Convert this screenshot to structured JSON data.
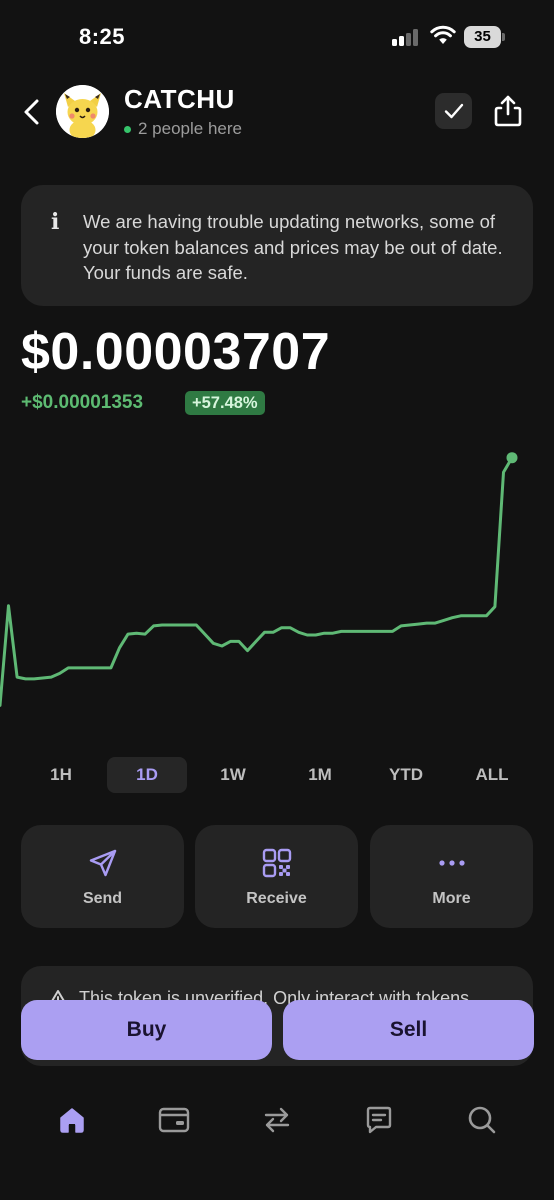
{
  "status_bar": {
    "time": "8:25",
    "battery": "35"
  },
  "header": {
    "token_name": "CATCHU",
    "presence": "2 people here"
  },
  "banner": {
    "icon": "info-icon",
    "message": "We are having trouble updating networks, some of your token balances and prices may be out of date. Your funds are safe."
  },
  "price": {
    "value": "$0.00003707",
    "change": "+$0.00001353",
    "change_pct": "+57.48%"
  },
  "chart_data": {
    "type": "line",
    "title": "",
    "xlabel": "",
    "ylabel": "",
    "range": "1D",
    "color": "#5fb975",
    "x": [
      0,
      1,
      2,
      3,
      4,
      5,
      6,
      7,
      8,
      9,
      10,
      11,
      12,
      13,
      14,
      15,
      16,
      17,
      18,
      19,
      20,
      21,
      22,
      23,
      24,
      25,
      26,
      27,
      28,
      29,
      30,
      31,
      32,
      33,
      34,
      35,
      36,
      37,
      38,
      39,
      40,
      41,
      42,
      43,
      44,
      45,
      46,
      47,
      48,
      49,
      50,
      51,
      52,
      53,
      54,
      55,
      56,
      57,
      58,
      59,
      60
    ],
    "y": [
      1e-05,
      2.09e-05,
      1.31e-05,
      1.29e-05,
      1.29e-05,
      1.3e-05,
      1.31e-05,
      1.35e-05,
      1.41e-05,
      1.41e-05,
      1.41e-05,
      1.41e-05,
      1.41e-05,
      1.41e-05,
      1.63e-05,
      1.78e-05,
      1.79e-05,
      1.78e-05,
      1.87e-05,
      1.88e-05,
      1.88e-05,
      1.88e-05,
      1.88e-05,
      1.88e-05,
      1.78e-05,
      1.68e-05,
      1.65e-05,
      1.7e-05,
      1.7e-05,
      1.6e-05,
      1.7e-05,
      1.8e-05,
      1.8e-05,
      1.85e-05,
      1.85e-05,
      1.8e-05,
      1.77e-05,
      1.77e-05,
      1.79e-05,
      1.79e-05,
      1.81e-05,
      1.81e-05,
      1.81e-05,
      1.81e-05,
      1.81e-05,
      1.81e-05,
      1.81e-05,
      1.87e-05,
      1.88e-05,
      1.89e-05,
      1.9e-05,
      1.9e-05,
      1.93e-05,
      1.96e-05,
      1.98e-05,
      1.98e-05,
      1.98e-05,
      1.98e-05,
      2.08e-05,
      3.55e-05,
      3.71e-05
    ],
    "ylim": [
      9.5e-06,
      3.75e-05
    ],
    "grid": false,
    "end_marker": true
  },
  "range_tabs": [
    {
      "label": "1H",
      "active": false
    },
    {
      "label": "1D",
      "active": true
    },
    {
      "label": "1W",
      "active": false
    },
    {
      "label": "1M",
      "active": false
    },
    {
      "label": "YTD",
      "active": false
    },
    {
      "label": "ALL",
      "active": false
    }
  ],
  "actions": {
    "send": {
      "label": "Send",
      "icon": "send-icon"
    },
    "receive": {
      "label": "Receive",
      "icon": "qr-code-icon"
    },
    "more": {
      "label": "More",
      "icon": "more-dots-icon"
    }
  },
  "warning": {
    "icon": "warning-icon",
    "text": "This token is unverified. Only interact with tokens"
  },
  "trade": {
    "buy": "Buy",
    "sell": "Sell"
  },
  "colors": {
    "accent": "#ab9ff2",
    "positive": "#5fb975",
    "background": "#121212",
    "card": "#242424"
  },
  "bottom_nav": [
    {
      "icon": "home-icon",
      "active": true
    },
    {
      "icon": "wallet-card-icon",
      "active": false
    },
    {
      "icon": "swap-icon",
      "active": false
    },
    {
      "icon": "chat-icon",
      "active": false
    },
    {
      "icon": "search-icon",
      "active": false
    }
  ]
}
